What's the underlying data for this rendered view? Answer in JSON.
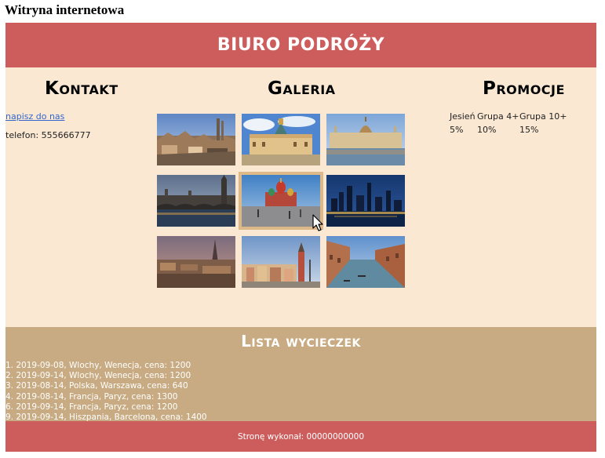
{
  "window_title": "Witryna internetowa",
  "banner": {
    "title": "BIURO PODRÓŻY"
  },
  "kontakt": {
    "heading": "Kontakt",
    "link_label": "napisz do nas",
    "phone": "telefon: 555666777"
  },
  "galeria": {
    "heading": "Galeria",
    "images": [
      {
        "name": "barcelona-gaudi-photo"
      },
      {
        "name": "berlin-charlottenburg-photo"
      },
      {
        "name": "budapest-parliament-photo"
      },
      {
        "name": "london-westminster-photo"
      },
      {
        "name": "moscow-red-square-photo"
      },
      {
        "name": "new-york-skyline-photo"
      },
      {
        "name": "paris-eiffel-photo"
      },
      {
        "name": "warsaw-old-town-photo"
      },
      {
        "name": "venice-grand-canal-photo"
      }
    ]
  },
  "promocje": {
    "heading": "Promocje",
    "rows": [
      [
        "Jesień",
        "Grupa 4+",
        "Grupa 10+"
      ],
      [
        "5%",
        "10%",
        "15%"
      ]
    ]
  },
  "lista": {
    "heading": "Lista wycieczek",
    "items": [
      "1. 2019-09-08, Wlochy, Wenecja, cena: 1200",
      "2. 2019-09-14, Wlochy, Wenecja, cena: 1200",
      "3. 2019-08-14, Polska, Warszawa, cena: 640",
      "4. 2019-08-14, Francja, Paryz, cena: 1300",
      "6. 2019-09-14, Francja, Paryz, cena: 1200",
      "9. 2019-09-14, Hiszpania, Barcelona, cena: 1400"
    ]
  },
  "footer": {
    "text": "Stronę wykonał: 00000000000"
  },
  "colors": {
    "banner": "#cd5c5c",
    "main_bg": "#fae8d3",
    "trips_bg": "#c8ab82",
    "hover_outline": "#ddb98a",
    "link": "#3366cc"
  }
}
